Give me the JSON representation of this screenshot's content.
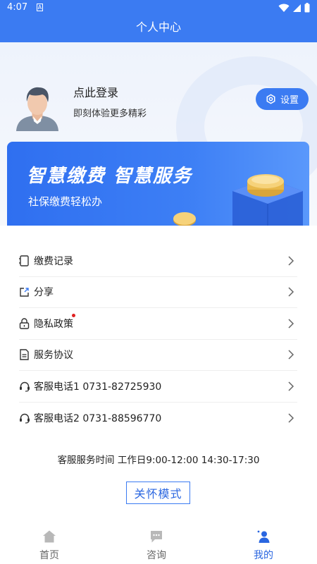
{
  "status_bar": {
    "time": "4:07",
    "badge": "A"
  },
  "header": {
    "title": "个人中心"
  },
  "profile": {
    "login_title": "点此登录",
    "login_subtitle": "即刻体验更多精彩",
    "settings_label": "设置"
  },
  "banner": {
    "title": "智慧缴费  智慧服务",
    "subtitle": "社保缴费轻松办"
  },
  "menu": {
    "items": [
      {
        "label": "缴费记录",
        "icon": "receipt-icon"
      },
      {
        "label": "分享",
        "icon": "share-icon"
      },
      {
        "label": "隐私政策",
        "icon": "lock-icon",
        "badge_dot": true
      },
      {
        "label": "服务协议",
        "icon": "document-icon"
      },
      {
        "label": "客服电话1 0731-82725930",
        "icon": "headset-icon"
      },
      {
        "label": "客服电话2 0731-88596770",
        "icon": "headset-icon"
      }
    ]
  },
  "service_hours": "客服服务时间 工作日9:00-12:00 14:30-17:30",
  "care_mode_label": "关怀模式",
  "tabs": [
    {
      "label": "首页",
      "icon": "home-icon",
      "active": false
    },
    {
      "label": "咨询",
      "icon": "chat-icon",
      "active": false
    },
    {
      "label": "我的",
      "icon": "user-icon",
      "active": true
    }
  ],
  "colors": {
    "primary": "#3b7bf2",
    "active_tab": "#2a66e0",
    "inactive_tab": "#b0b0b0",
    "badge": "#e02020"
  }
}
